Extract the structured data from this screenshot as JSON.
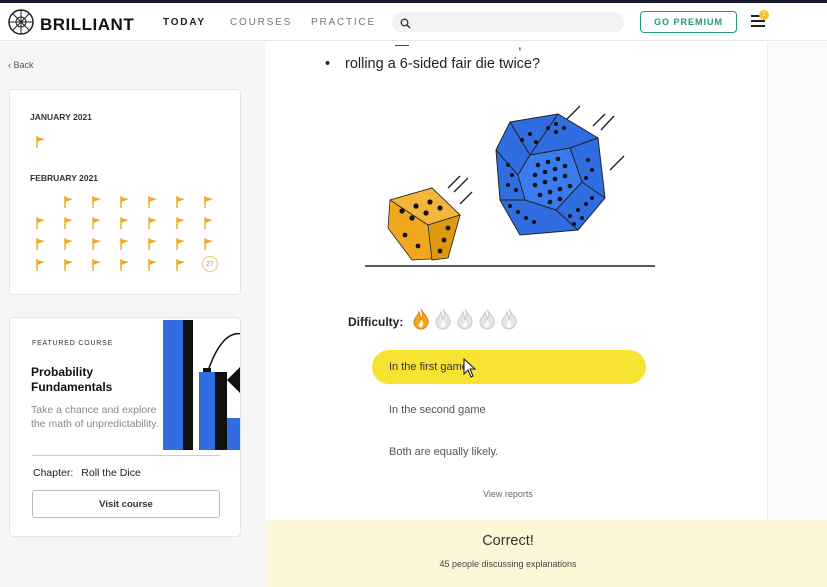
{
  "header": {
    "brand": "BRILLIANT",
    "nav": [
      "TODAY",
      "COURSES",
      "PRACTICE"
    ],
    "active_nav": "TODAY",
    "search_placeholder": "",
    "premium_label": "GO PREMIUM",
    "notification_count": "1"
  },
  "sidebar": {
    "back_label": "Back",
    "calendar": {
      "months": [
        {
          "name": "JANUARY 2021",
          "completed_days": 1
        },
        {
          "name": "FEBRUARY 2021",
          "completed_days": 26,
          "current_day": "27"
        }
      ],
      "flag_color": "#f0a81f"
    },
    "featured": {
      "label": "FEATURED COURSE",
      "title": "Probability Fundamentals",
      "description": "Take a chance and explore the math of unpredictability.",
      "chapter_label": "Chapter:",
      "chapter_value": "Roll the Dice",
      "button_label": "Visit course"
    }
  },
  "main": {
    "question_bullet": "rolling a 6-sided fair die twice?",
    "difficulty_label": "Difficulty:",
    "difficulty_level": 1,
    "difficulty_max": 5,
    "options": [
      {
        "label": "In the first game",
        "selected": true
      },
      {
        "label": "In the second game",
        "selected": false
      },
      {
        "label": "Both are equally likely.",
        "selected": false
      }
    ],
    "view_reports": "View reports"
  },
  "feedback": {
    "result": "Correct!",
    "discussion": "45 people discussing explanations"
  },
  "colors": {
    "accent_green": "#1f9d6e",
    "selected_option": "#f8e232",
    "feedback_bg": "#fdf6d6",
    "die_orange": "#f0a81f",
    "die_blue": "#2f6de0"
  }
}
